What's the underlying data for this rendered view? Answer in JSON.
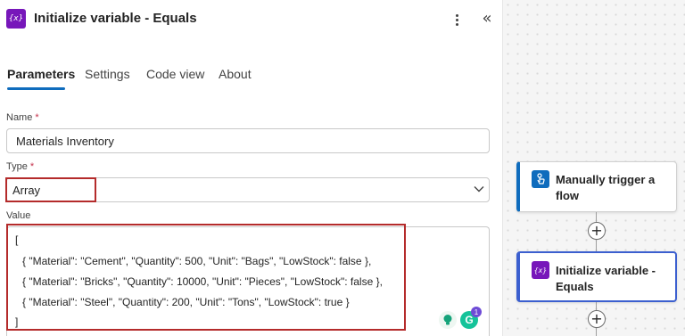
{
  "panel": {
    "icon": "variable-icon",
    "icon_glyph": "{x}",
    "title": "Initialize variable - Equals",
    "collapse_glyph": "«"
  },
  "tabs": [
    {
      "label": "Parameters",
      "active": true
    },
    {
      "label": "Settings",
      "active": false
    },
    {
      "label": "Code view",
      "active": false
    },
    {
      "label": "About",
      "active": false
    }
  ],
  "fields": {
    "name": {
      "label": "Name",
      "required_mark": "*",
      "value": "Materials Inventory"
    },
    "type": {
      "label": "Type",
      "required_mark": "*",
      "value": "Array"
    },
    "value": {
      "label": "Value",
      "lines": [
        "[",
        "{ \"Material\": \"Cement\", \"Quantity\": 500, \"Unit\": \"Bags\", \"LowStock\": false },",
        "{ \"Material\": \"Bricks\", \"Quantity\": 10000, \"Unit\": \"Pieces\", \"LowStock\": false },",
        "{ \"Material\": \"Steel\", \"Quantity\": 200, \"Unit\": \"Tons\", \"LowStock\": true }",
        "]"
      ]
    }
  },
  "grammarly": {
    "glyph": "G",
    "badge_count": "1"
  },
  "canvas": {
    "cards": [
      {
        "title": "Manually trigger a flow",
        "icon": "hand-touch-icon"
      },
      {
        "title": "Initialize variable - Equals",
        "icon": "variable-icon",
        "icon_glyph": "{x}"
      }
    ],
    "add_glyph": "+"
  },
  "colors": {
    "accent": "#0f6cbd",
    "variable_purple": "#7717ba",
    "highlight_red": "#b42b2b",
    "selected_border": "#3b5fcf"
  }
}
